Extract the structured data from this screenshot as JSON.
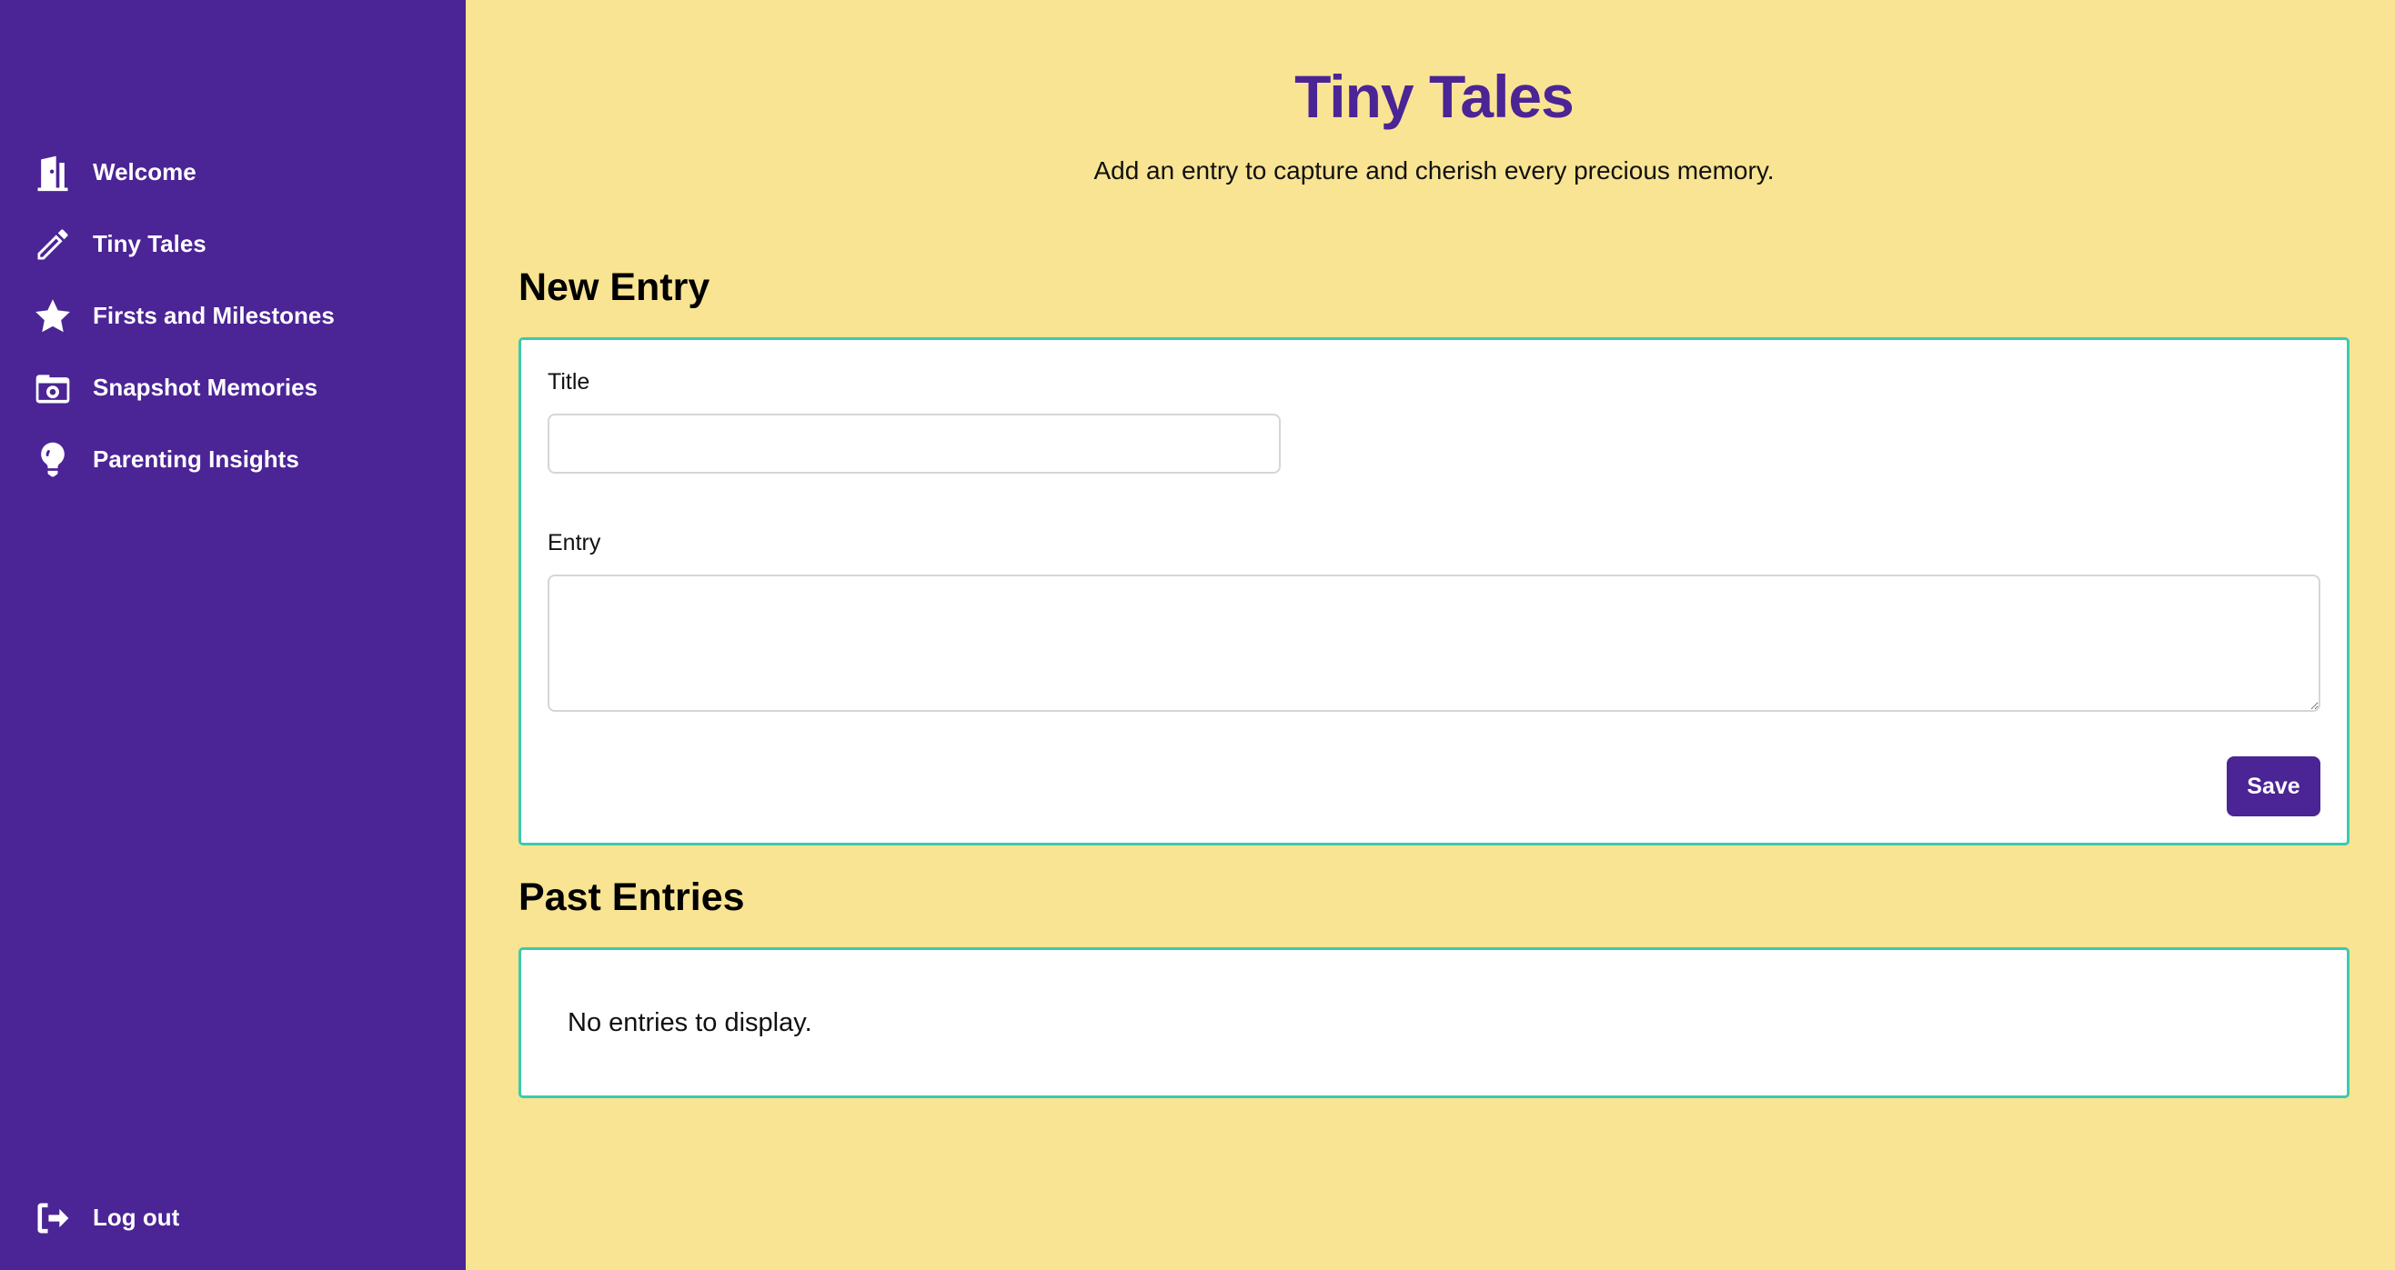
{
  "sidebar": {
    "items": [
      {
        "label": "Welcome",
        "icon": "door-open-icon"
      },
      {
        "label": "Tiny Tales",
        "icon": "pencil-icon"
      },
      {
        "label": "Firsts and Milestones",
        "icon": "star-icon"
      },
      {
        "label": "Snapshot Memories",
        "icon": "camera-icon"
      },
      {
        "label": "Parenting Insights",
        "icon": "lightbulb-icon"
      }
    ],
    "logout": {
      "label": "Log out",
      "icon": "logout-icon"
    }
  },
  "main": {
    "title": "Tiny Tales",
    "subtitle": "Add an entry to capture and cherish every precious memory.",
    "new_entry": {
      "heading": "New Entry",
      "title_label": "Title",
      "title_value": "",
      "entry_label": "Entry",
      "entry_value": "",
      "save_label": "Save"
    },
    "past_entries": {
      "heading": "Past Entries",
      "empty_text": "No entries to display."
    }
  },
  "colors": {
    "sidebar_bg": "#4b2495",
    "page_bg": "#f9e493",
    "accent_border": "#3cc9b0",
    "title_color": "#4b2495"
  }
}
